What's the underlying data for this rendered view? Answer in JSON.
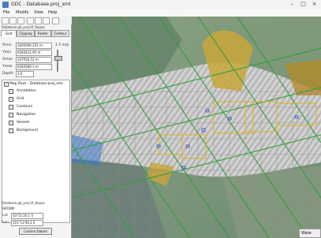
{
  "window": {
    "title": "GDC - Database.proj_xml",
    "close_glyph": "×",
    "min_glyph": "–",
    "max_glyph": "□"
  },
  "menu": [
    "File",
    "Modify",
    "View",
    "Help"
  ],
  "panel": {
    "path_text": "Database.gd_proj.tif_Kapaz",
    "tabs": [
      "Grid",
      "Clipping",
      "Raster",
      "Contour"
    ],
    "active_tab": "Grid",
    "fields": [
      {
        "label": "Xmin",
        "value": "3265000.231 m"
      },
      {
        "label": "Ymin",
        "value": "6283411.95 m"
      },
      {
        "label": "Xmax",
        "value": "337550.52 m"
      },
      {
        "label": "Ymax",
        "value": "6283580.1 m"
      },
      {
        "label": "Depth",
        "value": "1.0"
      }
    ],
    "scale_label": "1.5 m/p",
    "layer_header": "Map Root - Database.proj_xml",
    "layers": [
      "Annotation",
      "Grid",
      "Contours",
      "Navigation",
      "Vessels",
      "Background"
    ],
    "bottom_path": "Database.gd_proj.tif_Kapaz",
    "bottom_code": "SWDNM",
    "bottom_fields": [
      {
        "label": "Lat",
        "value": "33°51'20.1 S"
      },
      {
        "label": "Lon",
        "value": "151°13'40.2 E"
      }
    ],
    "bottom_button": "Custom Datum"
  },
  "status": {
    "text": "Wate"
  }
}
